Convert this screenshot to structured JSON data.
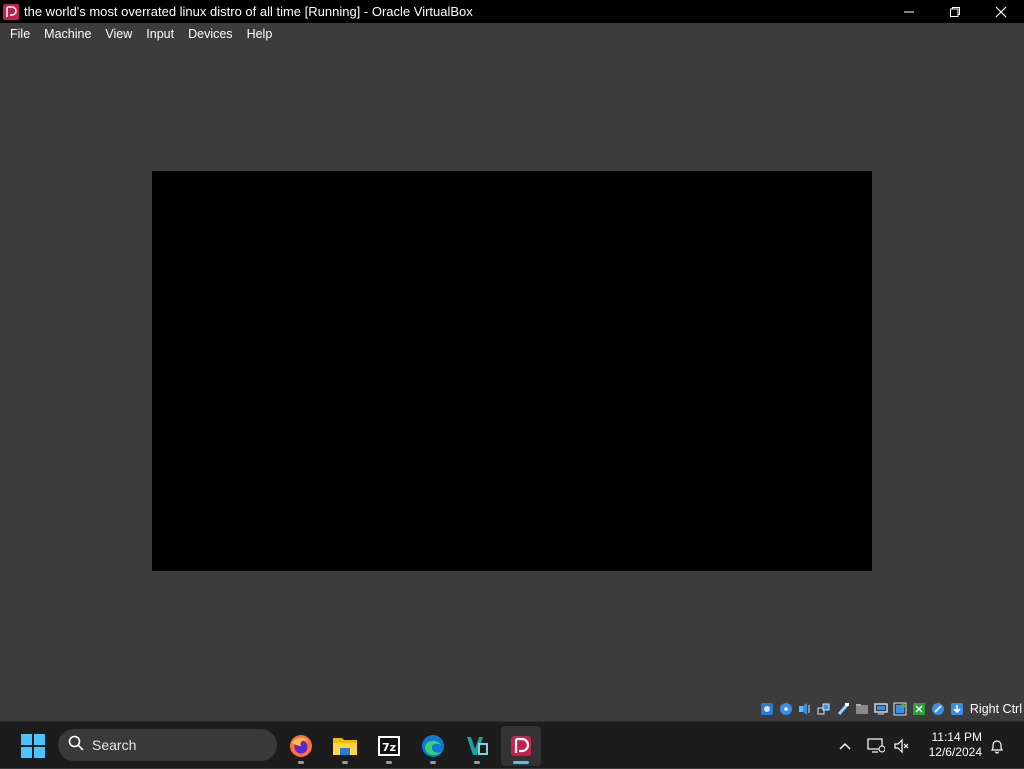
{
  "window": {
    "title": "the world's most overrated linux distro of all time [Running] - Oracle VirtualBox"
  },
  "menu": [
    {
      "label": "File"
    },
    {
      "label": "Machine"
    },
    {
      "label": "View"
    },
    {
      "label": "Input"
    },
    {
      "label": "Devices"
    },
    {
      "label": "Help"
    }
  ],
  "statusbar": {
    "icons": [
      "hard-disk-icon",
      "optical-drive-icon",
      "audio-icon",
      "network-icon",
      "usb-icon",
      "shared-folders-icon",
      "display-icon",
      "recording-icon",
      "cpu-icon",
      "mouse-integration-icon",
      "keyboard-capture-icon"
    ],
    "host_key": "Right Ctrl"
  },
  "taskbar": {
    "search_label": "Search",
    "apps": [
      "firefox",
      "file-explorer",
      "7zip",
      "edge",
      "vscode-like",
      "virtualbox"
    ],
    "active_app": "virtualbox",
    "clock_time": "11:14 PM",
    "clock_date": "12/6/2024"
  },
  "colors": {
    "window_bg": "#3c3c3c",
    "titlebar_bg": "#000000",
    "vm_screen": "#000000",
    "taskbar_bg": "#1c1c1c",
    "accent": "#4cc2ff"
  }
}
